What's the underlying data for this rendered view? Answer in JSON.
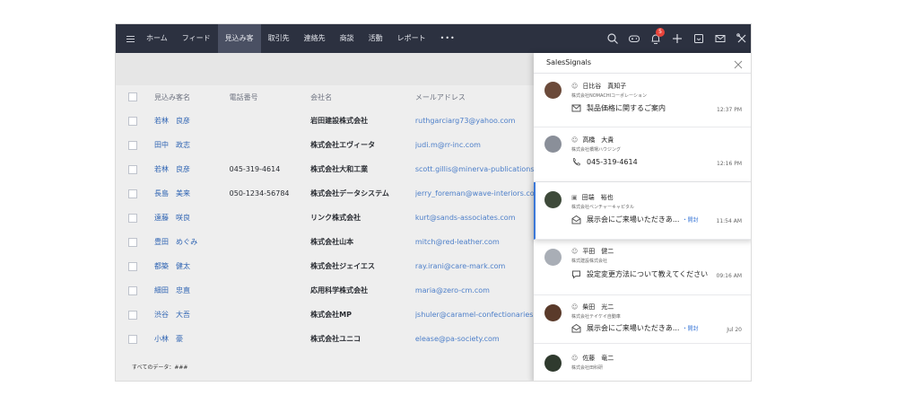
{
  "nav": {
    "items": [
      "ホーム",
      "フィード",
      "見込み客",
      "取引先",
      "連絡先",
      "商談",
      "活動",
      "レポート"
    ],
    "active_index": 2,
    "more": "•••",
    "notification_count": "5"
  },
  "table": {
    "headers": {
      "name": "見込み客名",
      "phone": "電話番号",
      "company": "会社名",
      "email": "メールアドレス"
    },
    "rows": [
      {
        "name": "若林　良彦",
        "phone": "",
        "company": "岩田建設株式会社",
        "email": "ruthgarciarg73@yahoo.com"
      },
      {
        "name": "田中　政志",
        "phone": "",
        "company": "株式会社エヴィータ",
        "email": "judi.m@rr-inc.com"
      },
      {
        "name": "若林　良彦",
        "phone": "045-319-4614",
        "company": "株式会社大和工業",
        "email": "scott.gillis@minerva-publications"
      },
      {
        "name": "長島　美来",
        "phone": "050-1234-56784",
        "company": "株式会社データシステム",
        "email": "jerry_foreman@wave-interiors.co"
      },
      {
        "name": "遠藤　咲良",
        "phone": "",
        "company": "リンク株式会社",
        "email": "kurt@sands-associates.com"
      },
      {
        "name": "豊田　めぐみ",
        "phone": "",
        "company": "株式会社山本",
        "email": "mitch@red-leather.com"
      },
      {
        "name": "都築　健太",
        "phone": "",
        "company": "株式会社ジェイエス",
        "email": "ray.irani@care-mark.com"
      },
      {
        "name": "細田　忠直",
        "phone": "",
        "company": "応用科学株式会社",
        "email": "maria@zero-cm.com"
      },
      {
        "name": "渋谷　大吾",
        "phone": "",
        "company": "株式会社MP",
        "email": "jshuler@caramel-confectionaries"
      },
      {
        "name": "小林　豪",
        "phone": "",
        "company": "株式会社ユニコ",
        "email": "elease@pa-society.com"
      }
    ],
    "footer": "すべてのデータ：###"
  },
  "signals": {
    "title": "SalesSignals",
    "cards": [
      {
        "name": "日比谷　真知子",
        "company": "株式会社NOMACHIコーポレーション",
        "activity": "製品価格に関するご案内",
        "extra": "",
        "time": "12:37 PM",
        "avatar_color": "#6b4a3a",
        "activity_icon": "mail-icon"
      },
      {
        "name": "高橋　大貴",
        "company": "株式会社橋場ハウジング",
        "activity": "045-319-4614",
        "extra": "",
        "time": "12:16 PM",
        "avatar_color": "#8a8f99",
        "activity_icon": "phone-icon"
      },
      {
        "name": "田端　裕也",
        "company": "株式会社ベンチャーキャピタル",
        "activity": "展示会にご来場いただきあ...",
        "extra": "・開封",
        "time": "11:54 AM",
        "avatar_color": "#3e4a3a",
        "activity_icon": "mail-open-icon"
      },
      {
        "name": "平田　健二",
        "company": "株式建設株式会社",
        "activity": "設定変更方法について教えてください",
        "extra": "",
        "time": "09:16 AM",
        "avatar_color": "#a9aeb6",
        "activity_icon": "chat-icon"
      },
      {
        "name": "柴田　光二",
        "company": "株式会社テイケイ自動車",
        "activity": "展示会にご来場いただきあ...",
        "extra": "・開封",
        "time": "Jul 20",
        "avatar_color": "#5a3a2a",
        "activity_icon": "mail-open-icon"
      },
      {
        "name": "佐藤　竜二",
        "company": "株式会社田科研",
        "activity": "",
        "extra": "",
        "time": "",
        "avatar_color": "#2f3a2e",
        "activity_icon": ""
      }
    ]
  },
  "colors": {
    "topbar": "#2c3140",
    "link": "#2f64b3",
    "accent": "#3b78d8",
    "badge": "#e8433a"
  }
}
